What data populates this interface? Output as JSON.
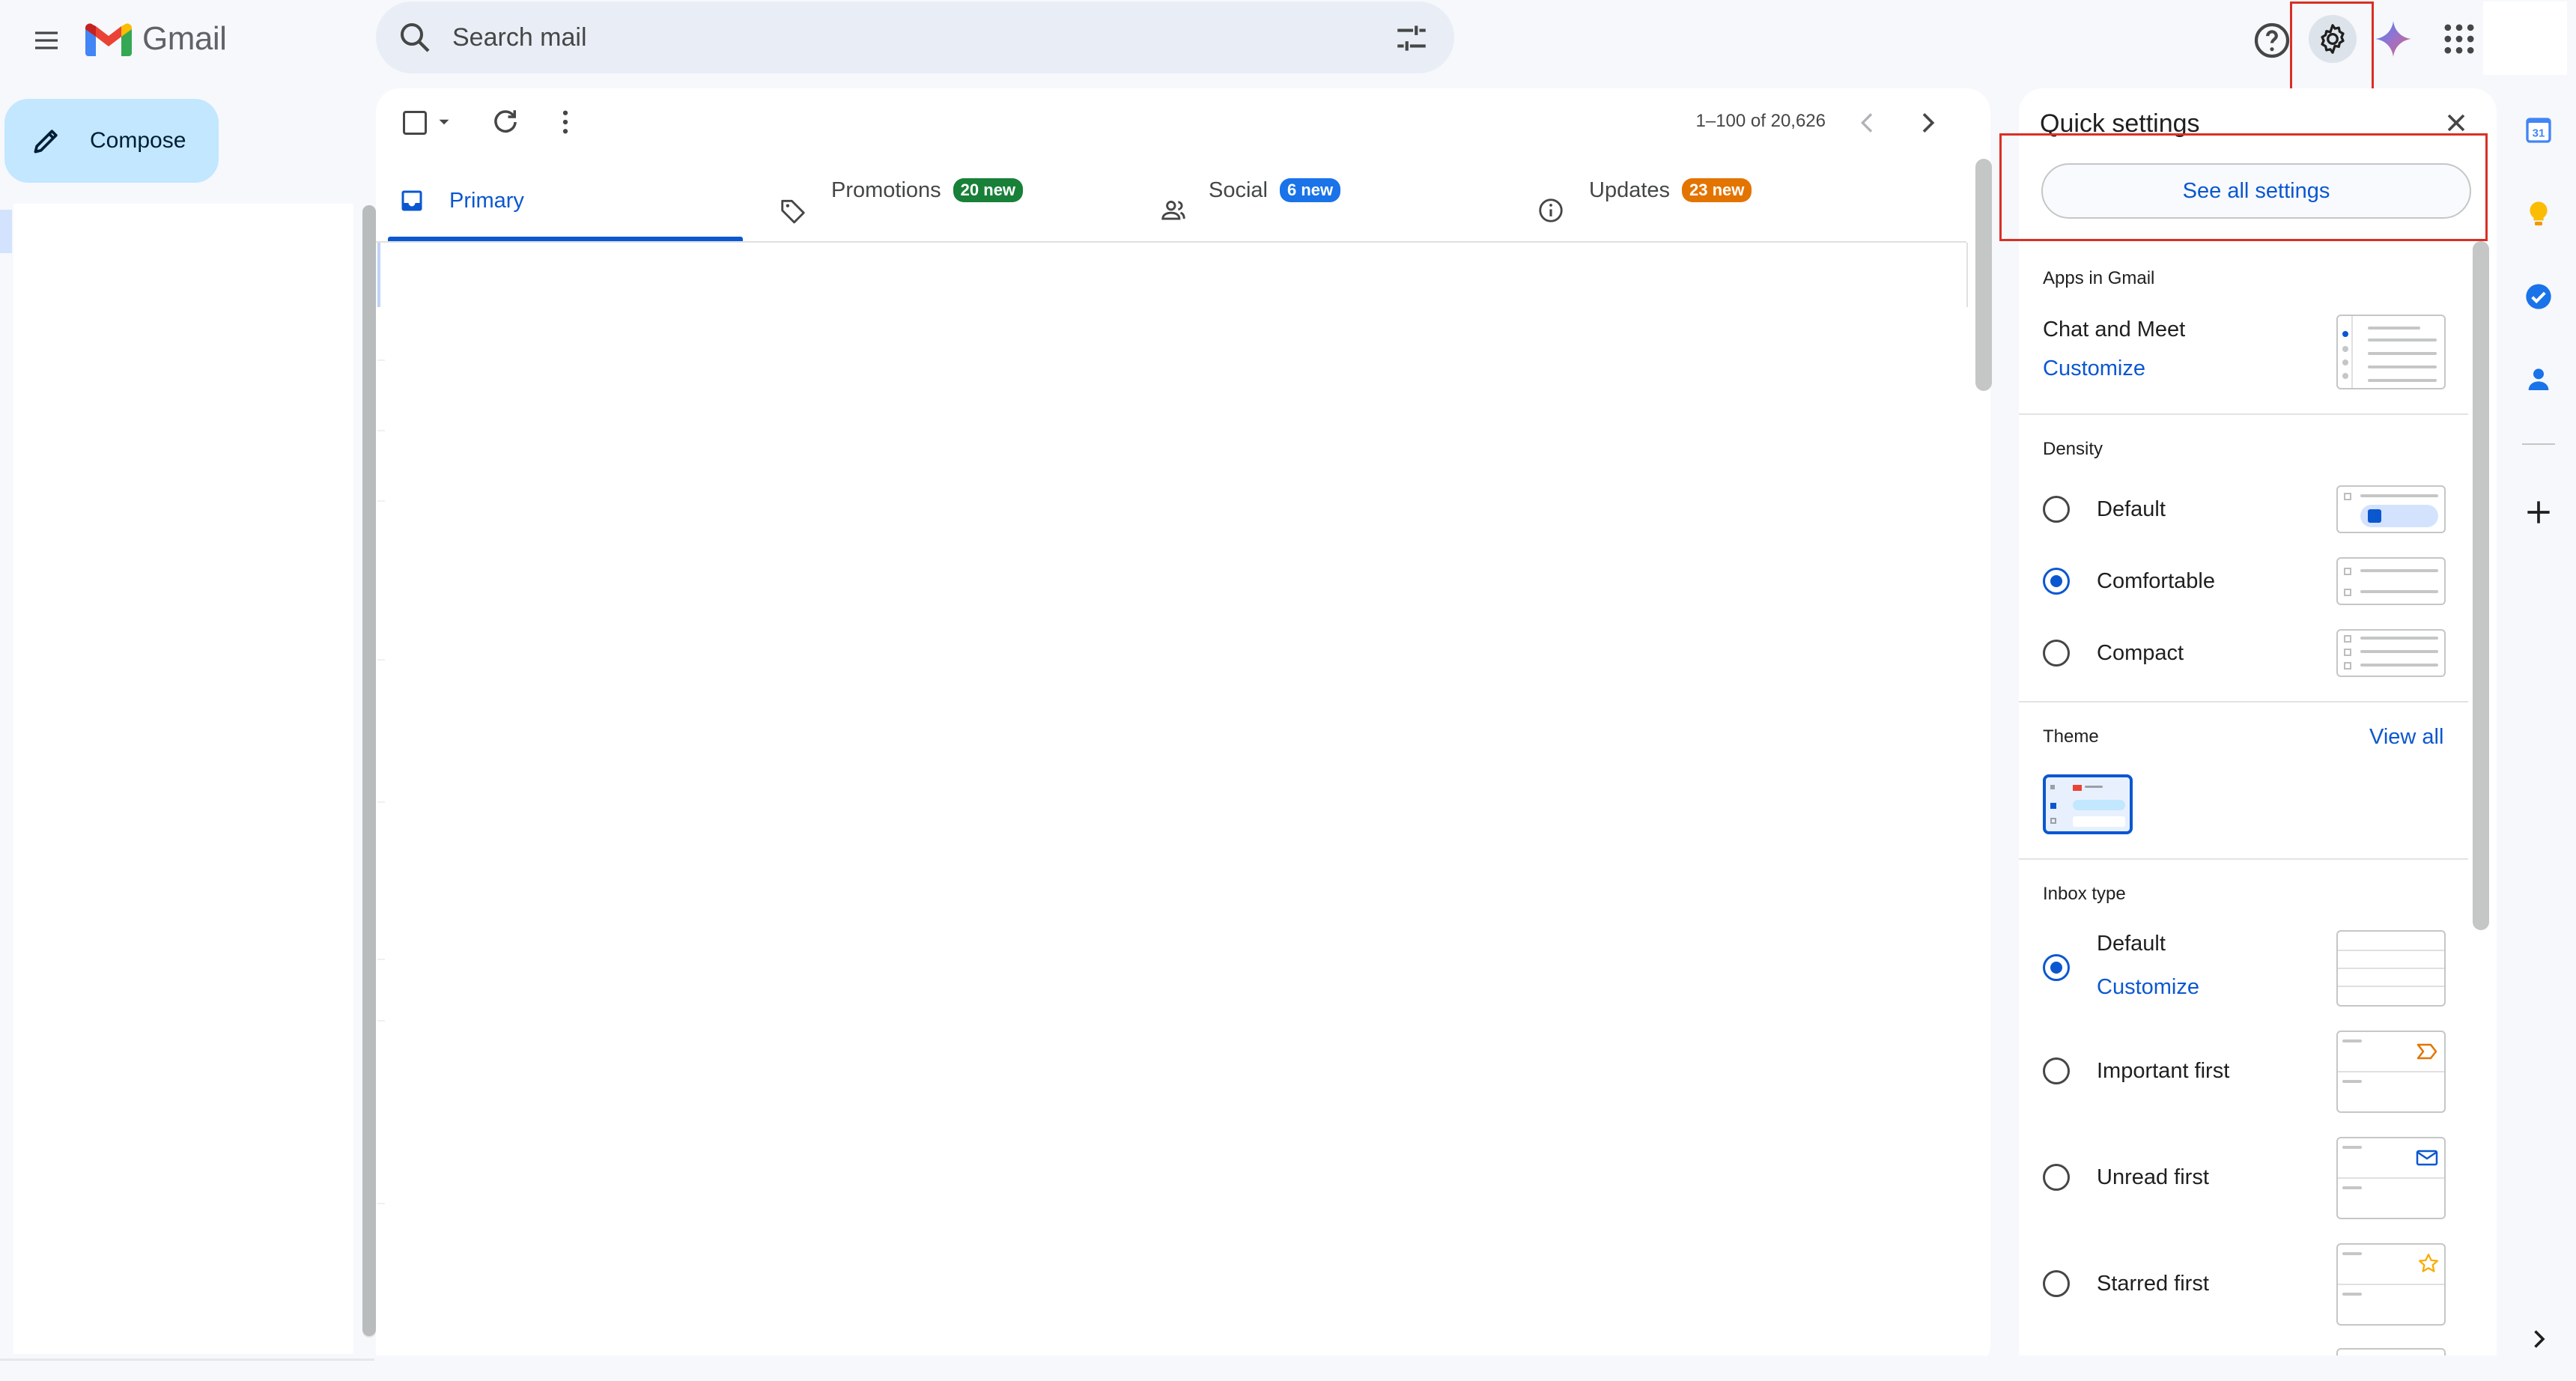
{
  "header": {
    "app_name": "Gmail",
    "search_placeholder": "Search mail",
    "icons": [
      "menu-icon",
      "search-icon",
      "search-options-icon",
      "help-icon",
      "settings-icon",
      "gemini-icon",
      "apps-icon"
    ]
  },
  "nav": {
    "compose_label": "Compose"
  },
  "toolbar": {
    "pagination": "1–100 of 20,626"
  },
  "tabs": [
    {
      "label": "Primary",
      "badge": "",
      "active": true
    },
    {
      "label": "Promotions",
      "badge": "20 new",
      "badge_color": "#188038"
    },
    {
      "label": "Social",
      "badge": "6 new",
      "badge_color": "#1a73e8"
    },
    {
      "label": "Updates",
      "badge": "23 new",
      "badge_color": "#e37400"
    }
  ],
  "quick_settings": {
    "title": "Quick settings",
    "see_all": "See all settings",
    "apps_section": "Apps in Gmail",
    "chat_meet": "Chat and Meet",
    "customize": "Customize",
    "density": {
      "title": "Density",
      "options": [
        {
          "label": "Default",
          "checked": false
        },
        {
          "label": "Comfortable",
          "checked": true
        },
        {
          "label": "Compact",
          "checked": false
        }
      ]
    },
    "theme": {
      "title": "Theme",
      "view_all": "View all"
    },
    "inbox_type": {
      "title": "Inbox type",
      "options": [
        {
          "label": "Default",
          "checked": true,
          "link": "Customize"
        },
        {
          "label": "Important first",
          "checked": false
        },
        {
          "label": "Unread first",
          "checked": false
        },
        {
          "label": "Starred first",
          "checked": false
        }
      ]
    }
  },
  "colors": {
    "accent": "#0b57d0",
    "highlight_box": "#d93025",
    "compose_bg": "#c2e7ff"
  }
}
